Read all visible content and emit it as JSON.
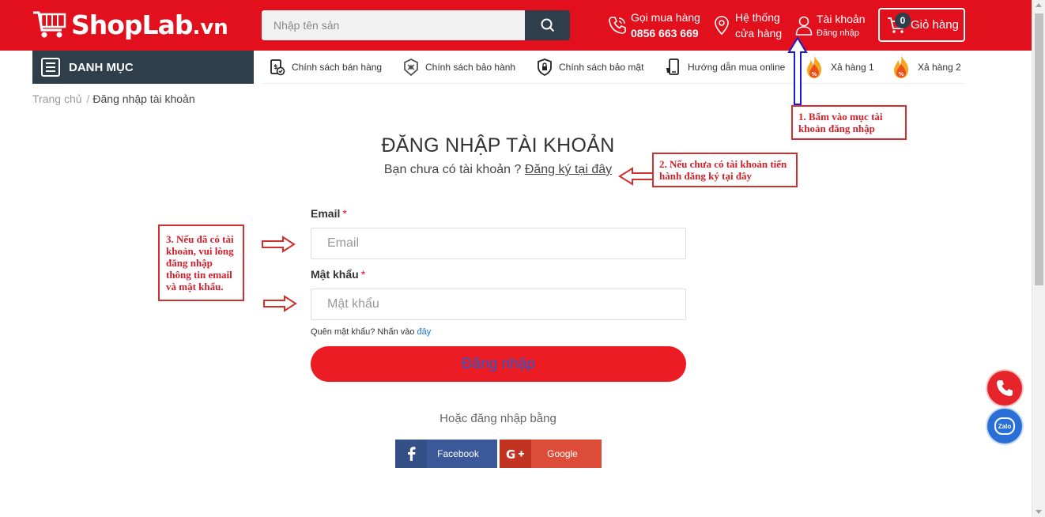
{
  "header": {
    "logo": {
      "brand": "ShopLab",
      "tld": ".vn"
    },
    "search": {
      "placeholder": "Nhập tên sản"
    },
    "hotline": {
      "label": "Gọi mua hàng",
      "number": "0856 663 669"
    },
    "stores": {
      "line1": "Hệ thống",
      "line2": "cửa hàng"
    },
    "account": {
      "label": "Tài khoản",
      "sub": "Đăng nhập"
    },
    "cart": {
      "count": "0",
      "label": "Giỏ hàng"
    }
  },
  "nav": {
    "category_label": "DANH MỤC",
    "items": [
      {
        "label": "Chính sách bán hàng",
        "icon": "sales-policy-icon"
      },
      {
        "label": "Chính sách bảo hành",
        "icon": "warranty-icon"
      },
      {
        "label": "Chính sách bảo mật",
        "icon": "privacy-shield-icon"
      },
      {
        "label": "Hướng dẫn mua online",
        "icon": "phone-guide-icon"
      },
      {
        "label": "Xả hàng 1",
        "icon": "fire-sale-icon"
      },
      {
        "label": "Xả hàng 2",
        "icon": "fire-sale-icon"
      }
    ]
  },
  "breadcrumb": {
    "home": "Trang chủ",
    "separator": "/",
    "current": "Đăng nhập tài khoản"
  },
  "form": {
    "title": "ĐĂNG NHẬP TÀI KHOẢN",
    "no_account": "Bạn chưa có tài khoản ?",
    "register_link": "Đăng ký tại đây",
    "email_label": "Email",
    "email_placeholder": "Email",
    "password_label": "Mật khẩu",
    "password_placeholder": "Mật khẩu",
    "required_mark": "*",
    "forgot_text": "Quên mật khẩu? Nhấn vào",
    "forgot_link": "đây",
    "submit": "Đăng nhập",
    "or_text": "Hoặc đăng nhập bằng",
    "facebook": "Facebook",
    "google": "Google"
  },
  "annotations": {
    "note1": "1. Bấm vào mục tài khoản đăng nhập",
    "note2": "2. Nếu chưa có tài khoản tiến hành đăng ký tại đây",
    "note3": "3. Nếu đã có tài khoản, vui lòng đăng nhập thông tin email và mật khẩu."
  },
  "floating": {
    "zalo_label": "Zalo"
  },
  "colors": {
    "brand_red": "#e20f1c",
    "dark_navy": "#2e3e4a",
    "annotation_red": "#d0202a",
    "annotation_blue": "#1a1ad0",
    "facebook": "#3b5998",
    "google": "#dd4b39"
  }
}
